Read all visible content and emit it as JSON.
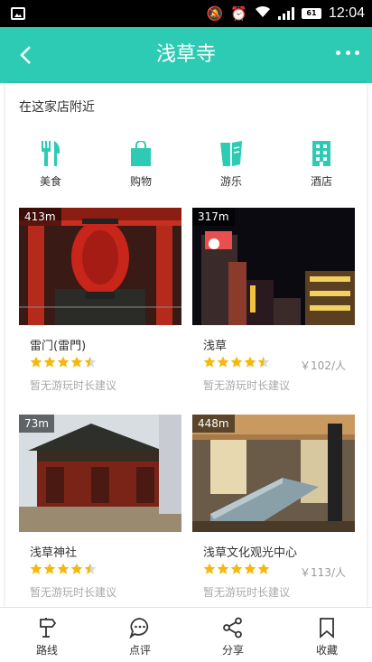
{
  "status_bar": {
    "time": "12:04",
    "battery": "61"
  },
  "header": {
    "title": "浅草寺"
  },
  "nearby": {
    "title": "在这家店附近",
    "categories": [
      {
        "label": "美食",
        "icon": "fork-knife-icon"
      },
      {
        "label": "购物",
        "icon": "shopping-bag-icon"
      },
      {
        "label": "游乐",
        "icon": "ticket-icon"
      },
      {
        "label": "酒店",
        "icon": "building-icon"
      }
    ],
    "places": [
      {
        "distance": "413m",
        "name": "雷门(雷門)",
        "rating": 4.5,
        "price": "",
        "hint": "暂无游玩时长建议"
      },
      {
        "distance": "317m",
        "name": "浅草",
        "rating": 4.5,
        "price": "￥102/人",
        "hint": "暂无游玩时长建议"
      },
      {
        "distance": "73m",
        "name": "浅草神社",
        "rating": 4.5,
        "price": "",
        "hint": "暂无游玩时长建议"
      },
      {
        "distance": "448m",
        "name": "浅草文化观光中心",
        "rating": 5,
        "price": "￥113/人",
        "hint": "暂无游玩时长建议"
      }
    ]
  },
  "bottom_bar": {
    "tabs": [
      {
        "label": "路线",
        "icon": "signpost-icon"
      },
      {
        "label": "点评",
        "icon": "comment-icon"
      },
      {
        "label": "分享",
        "icon": "share-icon"
      },
      {
        "label": "收藏",
        "icon": "bookmark-icon"
      }
    ]
  },
  "colors": {
    "accent": "#2ecbb4",
    "star": "#f5b80c",
    "status_bar": "#000000"
  }
}
